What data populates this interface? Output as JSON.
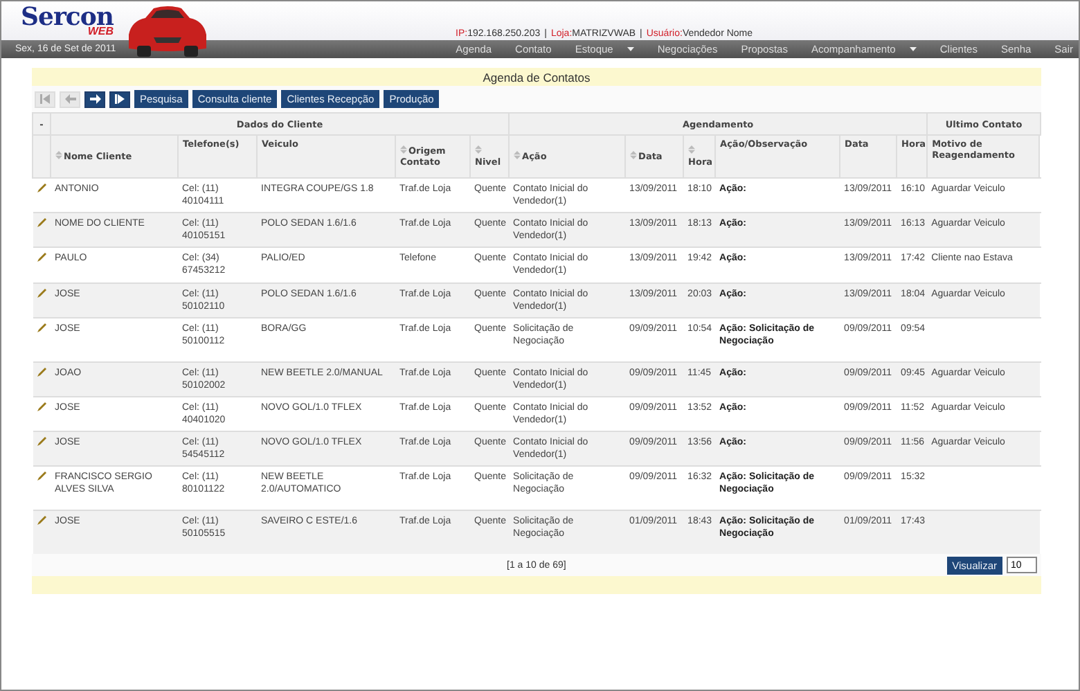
{
  "logo": {
    "name": "Sercon",
    "sub": "WEB"
  },
  "session": [
    {
      "label": "IP:",
      "value": "192.168.250.203"
    },
    {
      "label": "Loja:",
      "value": "MATRIZVWAB"
    },
    {
      "label": "Usuário:",
      "value": "Vendedor Nome"
    }
  ],
  "session_separator": "|",
  "date": "Sex, 16 de Set de 2011",
  "menu": [
    {
      "label": "Agenda",
      "dropdown": false
    },
    {
      "label": "Contato",
      "dropdown": false
    },
    {
      "label": "Estoque",
      "dropdown": true
    },
    {
      "label": "Negociações",
      "dropdown": false
    },
    {
      "label": "Propostas",
      "dropdown": false
    },
    {
      "label": "Acompanhamento",
      "dropdown": true
    },
    {
      "label": "Clientes",
      "dropdown": false
    },
    {
      "label": "Senha",
      "dropdown": false
    },
    {
      "label": "Sair",
      "dropdown": false
    }
  ],
  "title": "Agenda de Contatos",
  "pager_buttons": [
    {
      "kind": "first",
      "disabled": true
    },
    {
      "kind": "prev",
      "disabled": true
    },
    {
      "kind": "next",
      "disabled": false
    },
    {
      "kind": "last",
      "disabled": false
    }
  ],
  "actions": [
    "Pesquisa",
    "Consulta cliente",
    "Clientes Recepção",
    "Produção"
  ],
  "table": {
    "collapse": "-",
    "groups": [
      "Dados do Cliente",
      "Agendamento",
      "Ultimo Contato"
    ],
    "columns": [
      {
        "label": "Nome Cliente",
        "sortable": true
      },
      {
        "label": "Telefone(s)",
        "sortable": false
      },
      {
        "label": "Veiculo",
        "sortable": false
      },
      {
        "label": "Origem Contato",
        "sortable": true
      },
      {
        "label": "Nivel",
        "sortable": true
      },
      {
        "label": "Ação",
        "sortable": true
      },
      {
        "label": "Data",
        "sortable": true
      },
      {
        "label": "Hora",
        "sortable": true
      },
      {
        "label": "Ação/Observação",
        "sortable": false
      },
      {
        "label": "Data",
        "sortable": false
      },
      {
        "label": "Hora",
        "sortable": false
      },
      {
        "label": "Motivo de Reagendamento",
        "sortable": false
      }
    ],
    "rows": [
      {
        "cells": [
          "ANTONIO",
          "Cel: (11) 40104111",
          "INTEGRA COUPE/GS 1.8",
          "Traf.de Loja",
          "Quente",
          "Contato Inicial do Vendedor(1)",
          "13/09/2011",
          "18:10",
          "Ação:",
          "13/09/2011",
          "16:10",
          "Aguardar Veiculo"
        ]
      },
      {
        "cells": [
          "NOME DO CLIENTE",
          "Cel: (11) 40105151",
          "POLO SEDAN 1.6/1.6",
          "Traf.de Loja",
          "Quente",
          "Contato Inicial do Vendedor(1)",
          "13/09/2011",
          "18:13",
          "Ação:",
          "13/09/2011",
          "16:13",
          "Aguardar Veiculo"
        ]
      },
      {
        "cells": [
          "PAULO",
          "Cel: (34) 67453212",
          "PALIO/ED",
          "Telefone",
          "Quente",
          "Contato Inicial do Vendedor(1)",
          "13/09/2011",
          "19:42",
          "Ação:",
          "13/09/2011",
          "17:42",
          "Cliente nao Estava"
        ]
      },
      {
        "cells": [
          "JOSE",
          "Cel: (11) 50102110",
          "POLO SEDAN 1.6/1.6",
          "Traf.de Loja",
          "Quente",
          "Contato Inicial do Vendedor(1)",
          "13/09/2011",
          "20:03",
          "Ação:",
          "13/09/2011",
          "18:04",
          "Aguardar Veiculo"
        ]
      },
      {
        "cells": [
          "JOSE",
          "Cel: (11) 50100112",
          "BORA/GG",
          "Traf.de Loja",
          "Quente",
          "Solicitação de Negociação",
          "09/09/2011",
          "10:54",
          "Ação: Solicitação de Negociação",
          "09/09/2011",
          "09:54",
          ""
        ]
      },
      {
        "cells": [
          "JOAO",
          "Cel: (11) 50102002",
          "NEW BEETLE 2.0/MANUAL",
          "Traf.de Loja",
          "Quente",
          "Contato Inicial do Vendedor(1)",
          "09/09/2011",
          "11:45",
          "Ação:",
          "09/09/2011",
          "09:45",
          "Aguardar Veiculo"
        ]
      },
      {
        "cells": [
          "JOSE",
          "Cel: (11) 40401020",
          "NOVO GOL/1.0 TFLEX",
          "Traf.de Loja",
          "Quente",
          "Contato Inicial do Vendedor(1)",
          "09/09/2011",
          "13:52",
          "Ação:",
          "09/09/2011",
          "11:52",
          "Aguardar Veiculo"
        ]
      },
      {
        "cells": [
          "JOSE",
          "Cel: (11) 54545112",
          "NOVO GOL/1.0 TFLEX",
          "Traf.de Loja",
          "Quente",
          "Contato Inicial do Vendedor(1)",
          "09/09/2011",
          "13:56",
          "Ação:",
          "09/09/2011",
          "11:56",
          "Aguardar Veiculo"
        ]
      },
      {
        "cells": [
          "FRANCISCO SERGIO ALVES SILVA",
          "Cel: (11) 80101122",
          "NEW BEETLE 2.0/AUTOMATICO",
          "Traf.de Loja",
          "Quente",
          "Solicitação de Negociação",
          "09/09/2011",
          "16:32",
          "Ação: Solicitação de Negociação",
          "09/09/2011",
          "15:32",
          ""
        ]
      },
      {
        "cells": [
          "JOSE",
          "Cel: (11) 50105515",
          "SAVEIRO C ESTE/1.6",
          "Traf.de Loja",
          "Quente",
          "Solicitação de Negociação",
          "01/09/2011",
          "18:43",
          "Ação: Solicitação de Negociação",
          "01/09/2011",
          "17:43",
          ""
        ]
      }
    ]
  },
  "pagination": "[1 a 10 de 69]",
  "view_button": "Visualizar",
  "page_size": "10"
}
